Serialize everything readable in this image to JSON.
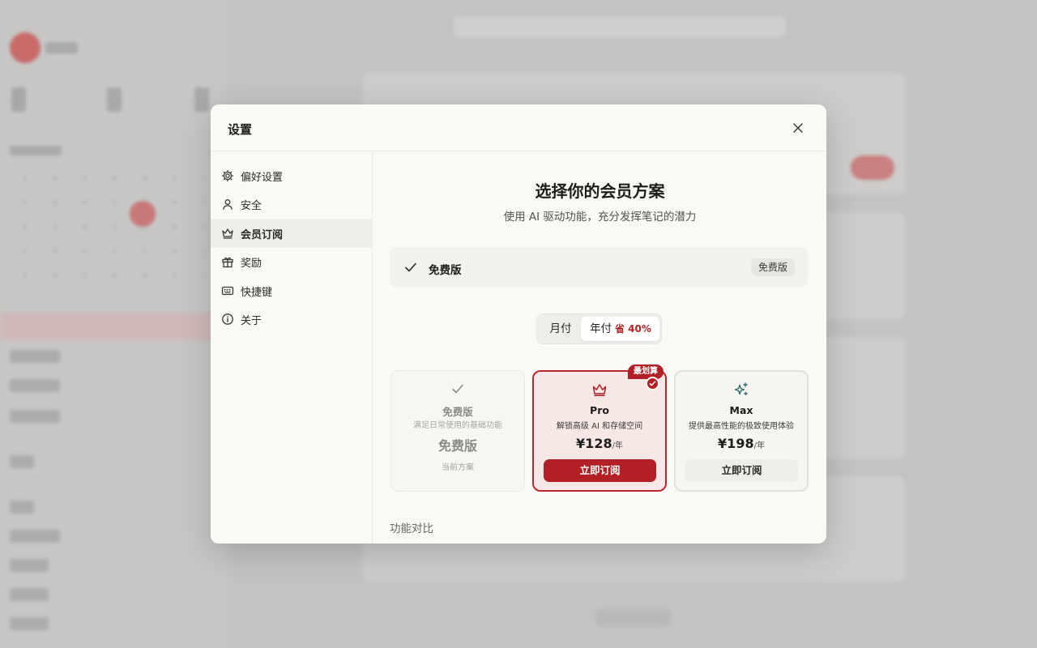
{
  "modal": {
    "title": "设置"
  },
  "sidebar": {
    "items": [
      {
        "label": "偏好设置",
        "icon": "gear-icon"
      },
      {
        "label": "安全",
        "icon": "user-icon"
      },
      {
        "label": "会员订阅",
        "icon": "crown-icon",
        "active": true
      },
      {
        "label": "奖励",
        "icon": "gift-icon"
      },
      {
        "label": "快捷键",
        "icon": "keyboard-icon"
      },
      {
        "label": "关于",
        "icon": "info-icon"
      }
    ]
  },
  "content": {
    "title": "选择你的会员方案",
    "subtitle": "使用 AI 驱动功能，充分发挥笔记的潜力",
    "current_plan": {
      "name": "免费版",
      "badge": "免费版"
    },
    "billing": {
      "monthly_label": "月付",
      "yearly_label": "年付",
      "yearly_save": "省 40%",
      "selected": "yearly"
    },
    "plans": [
      {
        "name": "免费版",
        "desc": "满足日常使用的基础功能",
        "price": "免费版",
        "status": "当前方案",
        "icon": "check-icon"
      },
      {
        "name": "Pro",
        "desc": "解锁高级 AI 和存储空间",
        "price": "¥128",
        "unit": "/年",
        "button": "立即订阅",
        "badge": "最划算",
        "icon": "crown-icon",
        "selected": true
      },
      {
        "name": "Max",
        "desc": "提供最高性能的极致使用体验",
        "price": "¥198",
        "unit": "/年",
        "button": "立即订阅",
        "icon": "sparkles-icon"
      }
    ],
    "compare_title": "功能对比"
  },
  "colors": {
    "accent": "#b21f24",
    "modal_bg": "#faf9f6",
    "overlay": "#c4c3c1",
    "max_icon": "#2f6b70"
  }
}
